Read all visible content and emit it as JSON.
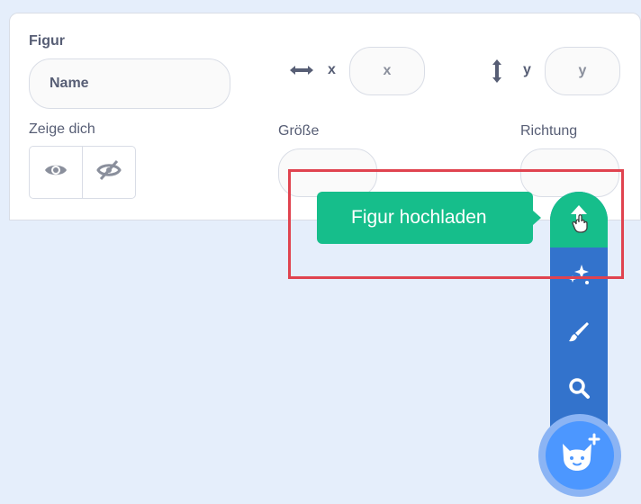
{
  "sprite_info": {
    "sprite_label": "Figur",
    "name_placeholder": "Name",
    "x_label": "x",
    "x_placeholder": "x",
    "y_label": "y",
    "y_placeholder": "y",
    "show_label": "Zeige dich",
    "size_label": "Größe",
    "direction_label": "Richtung"
  },
  "sprite_menu": {
    "tooltip": "Figur hochladen",
    "items": [
      "upload-sprite",
      "surprise",
      "paint",
      "choose-sprite"
    ]
  },
  "colors": {
    "accent_green": "#16be8b",
    "menu_blue": "#3373cc",
    "cat_button": "#4c97ff",
    "highlight": "#e0434f"
  }
}
